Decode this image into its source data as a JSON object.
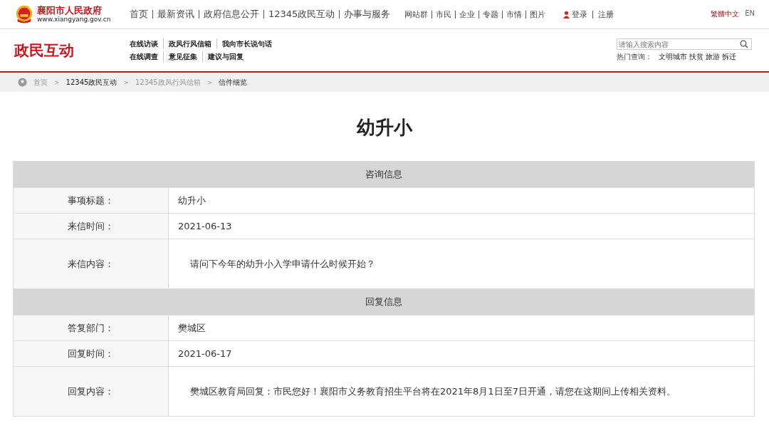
{
  "header": {
    "site_name": "襄阳市人民政府",
    "site_url": "www.xiangyang.gov.cn",
    "nav": [
      "首页",
      "最新资讯",
      "政府信息公开",
      "12345政民互动",
      "办事与服务"
    ],
    "site_links": [
      "网站群",
      "市民",
      "企业",
      "专题",
      "市情",
      "图片"
    ],
    "login": "登录",
    "register": "注册",
    "languages": [
      "繁體中文",
      "EN"
    ]
  },
  "channel": {
    "title": "政民互动",
    "links": [
      [
        "在线访谈",
        "政风行风信箱",
        "我向市长说句话"
      ],
      [
        "在线调查",
        "意见征集",
        "建议与回复"
      ]
    ],
    "search": {
      "placeholder": "请输入搜索内容"
    },
    "hot_label": "热门查询：",
    "hot_terms": [
      "文明城市",
      "扶贫",
      "旅游",
      "拆迁"
    ]
  },
  "breadcrumb": [
    "首页",
    "12345政民互动",
    "12345政风行风信箱",
    "信件细览"
  ],
  "breadcrumb_separators": [
    ">",
    ">",
    ">"
  ],
  "page_title": "幼升小",
  "sections": [
    {
      "title": "咨询信息",
      "rows": [
        {
          "kind": "short",
          "label": "事项标题：",
          "value": "幼升小"
        },
        {
          "kind": "short",
          "label": "来信时间：",
          "value": "2021-06-13"
        },
        {
          "kind": "content",
          "label": "来信内容：",
          "value": "请问下今年的幼升小入学申请什么时候开始？"
        }
      ]
    },
    {
      "title": "回复信息",
      "rows": [
        {
          "kind": "short",
          "label": "答复部门：",
          "value": "樊城区"
        },
        {
          "kind": "short",
          "label": "回复时间：",
          "value": "2021-06-17"
        },
        {
          "kind": "content",
          "label": "回复内容：",
          "value": "樊城区教育局回复：市民您好！襄阳市义务教育招生平台将在2021年8月1日至7日开通，请您在这期间上传相关资料。"
        }
      ]
    }
  ]
}
